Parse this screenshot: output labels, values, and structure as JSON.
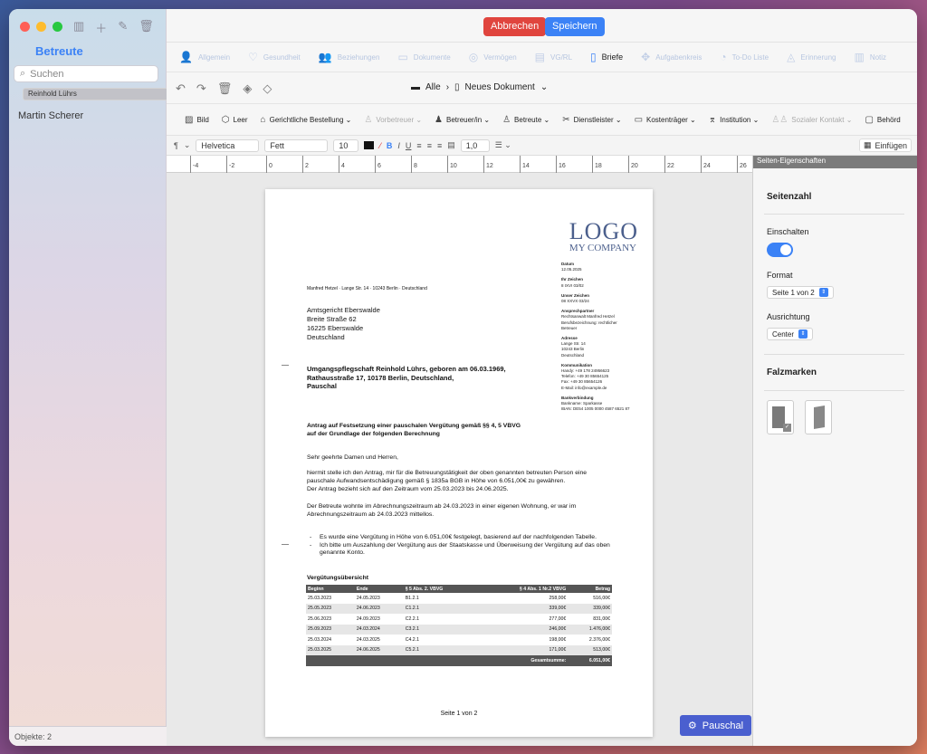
{
  "sidebar": {
    "title": "Betreute",
    "search_placeholder": "Suchen",
    "items": [
      {
        "label": "Reinhold Lührs",
        "selected": true
      },
      {
        "label": "Martin Scherer",
        "selected": false
      }
    ],
    "footer": "Objekte: 2"
  },
  "toolbar": {
    "cancel_label": "Abbrechen",
    "save_label": "Speichern",
    "accent": "#3b82f6",
    "danger": "#e0453e"
  },
  "tabs": [
    {
      "label": "Allgemein",
      "icon": "person-icon"
    },
    {
      "label": "Gesundheit",
      "icon": "health-icon"
    },
    {
      "label": "Beziehungen",
      "icon": "people-icon"
    },
    {
      "label": "Dokumente",
      "icon": "folder-icon"
    },
    {
      "label": "Vermögen",
      "icon": "money-icon"
    },
    {
      "label": "VG/RL",
      "icon": "vg-icon"
    },
    {
      "label": "Briefe",
      "icon": "document-icon",
      "active": true
    },
    {
      "label": "Aufgabenkreis",
      "icon": "tasks-icon"
    },
    {
      "label": "To-Do Liste",
      "icon": "todo-icon"
    },
    {
      "label": "Erinnerung",
      "icon": "bell-icon"
    },
    {
      "label": "Notiz",
      "icon": "note-icon"
    }
  ],
  "breadcrumb": {
    "root": "Alle",
    "current": "Neues Dokument"
  },
  "insert_bar": [
    {
      "label": "Bild",
      "icon": "image-icon"
    },
    {
      "label": "Leer",
      "icon": "cube-icon"
    },
    {
      "label": "Gerichtliche Bestellung ⌄",
      "icon": "court-icon"
    },
    {
      "label": "Vorbetreuer ⌄",
      "icon": "person-icon",
      "dim": true
    },
    {
      "label": "Betreuer/in ⌄",
      "icon": "person-icon"
    },
    {
      "label": "Betreute ⌄",
      "icon": "person-icon"
    },
    {
      "label": "Dienstleister ⌄",
      "icon": "tools-icon"
    },
    {
      "label": "Kostenträger ⌄",
      "icon": "card-icon"
    },
    {
      "label": "Institution ⌄",
      "icon": "graduation-icon"
    },
    {
      "label": "Sozialer Kontakt ⌄",
      "icon": "people-icon",
      "dim": true
    },
    {
      "label": "Behörd",
      "icon": "bag-icon"
    }
  ],
  "format": {
    "paragraph": "¶",
    "font": "Helvetica",
    "style": "Fett",
    "size": "10",
    "spacing": "1,0",
    "insert_label": "Einfügen"
  },
  "ruler": [
    "-4",
    "-2",
    "0",
    "2",
    "4",
    "6",
    "8",
    "10",
    "12",
    "14",
    "16",
    "18",
    "20",
    "22",
    "24",
    "26"
  ],
  "letter": {
    "logo_top": "LOGO",
    "logo_bottom": "MY COMPANY",
    "sender_line": "Manfred Hetzel · Lange Str. 14 · 10243 Berlin · Deutschland",
    "recipient": [
      "Amtsgericht Eberswalde",
      "Breite Straße 62",
      "16225 Eberswalde",
      "Deutschland"
    ],
    "info": [
      {
        "h": "Datum",
        "lines": [
          "12.05.2025"
        ]
      },
      {
        "h": "Ihr Zeichen",
        "lines": [
          "8 IXVI 03/02"
        ]
      },
      {
        "h": "Unser Zeichen",
        "lines": [
          "08 XXVX 03/24"
        ]
      },
      {
        "h": "Ansprechpartner",
        "lines": [
          "Rechtsanwalt Manfred Hetzel",
          "Berufsbezeichnung: rechtlicher",
          "Betreuer"
        ]
      },
      {
        "h": "Adresse",
        "lines": [
          "Lange Str. 14",
          "10243 Berlin",
          "Deutschland"
        ]
      },
      {
        "h": "Kommunikation",
        "lines": [
          "Handy: +49 178 24956623",
          "Telefon: +49 30 85654125",
          "Fax: +49 30 85654126",
          "E-Mail: info@example.de"
        ]
      },
      {
        "h": "Bankverbindung",
        "lines": [
          "Bankname: Sparkasse",
          "IBAN: DE54 1005 0000 4587 6521 87"
        ]
      }
    ],
    "subject": [
      "Umgangspflegschaft Reinhold Lührs, geboren am 06.03.1969,",
      "Rathausstraße 17, 10178 Berlin, Deutschland,",
      "Pauschal"
    ],
    "heading": [
      "Antrag auf Festsetzung einer pauschalen Vergütung gemäß §§ 4, 5 VBVG",
      "auf der Grundlage der folgenden Berechnung"
    ],
    "salutation": "Sehr geehrte Damen und Herren,",
    "p1": "hiermit stelle ich den Antrag, mir für die Betreuungstätigkeit der oben genannten betreuten Person eine pauschale Aufwandsentschädigung gemäß § 1835a BGB in Höhe von 6.051,00€ zu gewähren.",
    "p2": "Der Antrag bezieht sich auf den Zeitraum vom 25.03.2023 bis 24.06.2025.",
    "p3": "Der Betreute wohnte im Abrechnungszeitraum ab 24.03.2023 in einer eigenen Wohnung, er war im Abrechnungszeitraum ab 24.03.2023 mittellos.",
    "bullet1": "Es wurde eine Vergütung in Höhe von 6.051,00€ festgelegt, basierend auf der nachfolgenden Tabelle.",
    "bullet2": "Ich bitte um Auszahlung der Vergütung aus der Staatskasse und Überweisung der Vergütung auf das oben genannte Konto.",
    "table_title": "Vergütungsübersicht",
    "table_headers": [
      "Beginn",
      "Ende",
      "§ 5 Abs. 2. VBVG",
      "§ 4 Abs. 1 Nr.2 VBVG",
      "Betrag"
    ],
    "table_rows": [
      [
        "25.03.2023",
        "24.05.2023",
        "B1.2.1",
        "258,00€",
        "516,00€"
      ],
      [
        "25.05.2023",
        "24.06.2023",
        "C1.2.1",
        "339,00€",
        "339,00€"
      ],
      [
        "25.06.2023",
        "24.09.2023",
        "C2.2.1",
        "277,00€",
        "831,00€"
      ],
      [
        "25.09.2023",
        "24.03.2024",
        "C3.2.1",
        "246,00€",
        "1.476,00€"
      ],
      [
        "25.03.2024",
        "24.03.2025",
        "C4.2.1",
        "198,00€",
        "2.376,00€"
      ],
      [
        "25.03.2025",
        "24.06.2025",
        "C5.2.1",
        "171,00€",
        "513,00€"
      ]
    ],
    "total_label": "Gesamtsumme:",
    "total_value": "6.051,00€",
    "page_number": "Seite 1 von 2"
  },
  "float_button": "Pauschal",
  "inspector": {
    "header": "Seiten-Eigenschaften",
    "section_pages": "Seitenzahl",
    "enable_label": "Einschalten",
    "enabled": true,
    "format_label": "Format",
    "format_value": "Seite 1 von 2",
    "align_label": "Ausrichtung",
    "align_value": "Center",
    "section_fold": "Falzmarken"
  }
}
